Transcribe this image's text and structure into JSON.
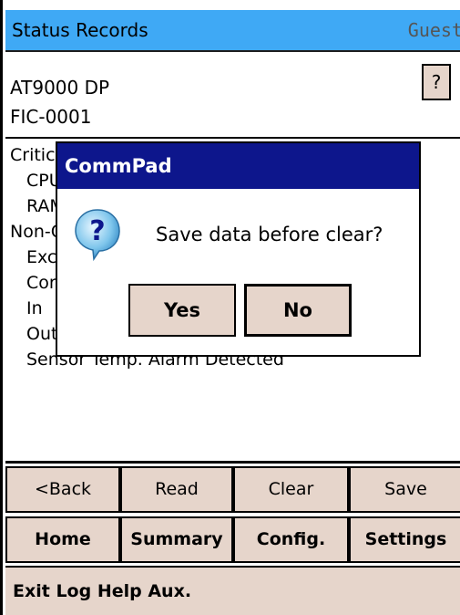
{
  "header": {
    "title": "Status Records",
    "user": "Guest"
  },
  "device": {
    "model": "AT9000 DP",
    "tag": "FIC-0001"
  },
  "help_button": {
    "label": "?"
  },
  "records": [
    {
      "text": "Critical",
      "indent": false
    },
    {
      "text": "CPU",
      "indent": true
    },
    {
      "text": "RAM",
      "indent": true
    },
    {
      "text": "Non-Critical",
      "indent": false
    },
    {
      "text": "Exc",
      "indent": true
    },
    {
      "text": "Cor",
      "indent": true
    },
    {
      "text": "In",
      "indent": true
    },
    {
      "text": "Out",
      "indent": true
    },
    {
      "text": "Sensor Temp. Alarm Detected",
      "indent": true
    }
  ],
  "toolbar_row1": [
    "<Back",
    "Read",
    "Clear",
    "Save"
  ],
  "toolbar_row2": [
    "Home",
    "Summary",
    "Config.",
    "Settings"
  ],
  "menubar": {
    "label": "Exit Log Help Aux."
  },
  "dialog": {
    "title": "CommPad",
    "message": "Save data before clear?",
    "yes_label": "Yes",
    "no_label": "No",
    "icon": "question-icon"
  },
  "colors": {
    "title_bar": "#3fa9f5",
    "dialog_title": "#0d168c",
    "button_bg": "#e6d5cb"
  }
}
